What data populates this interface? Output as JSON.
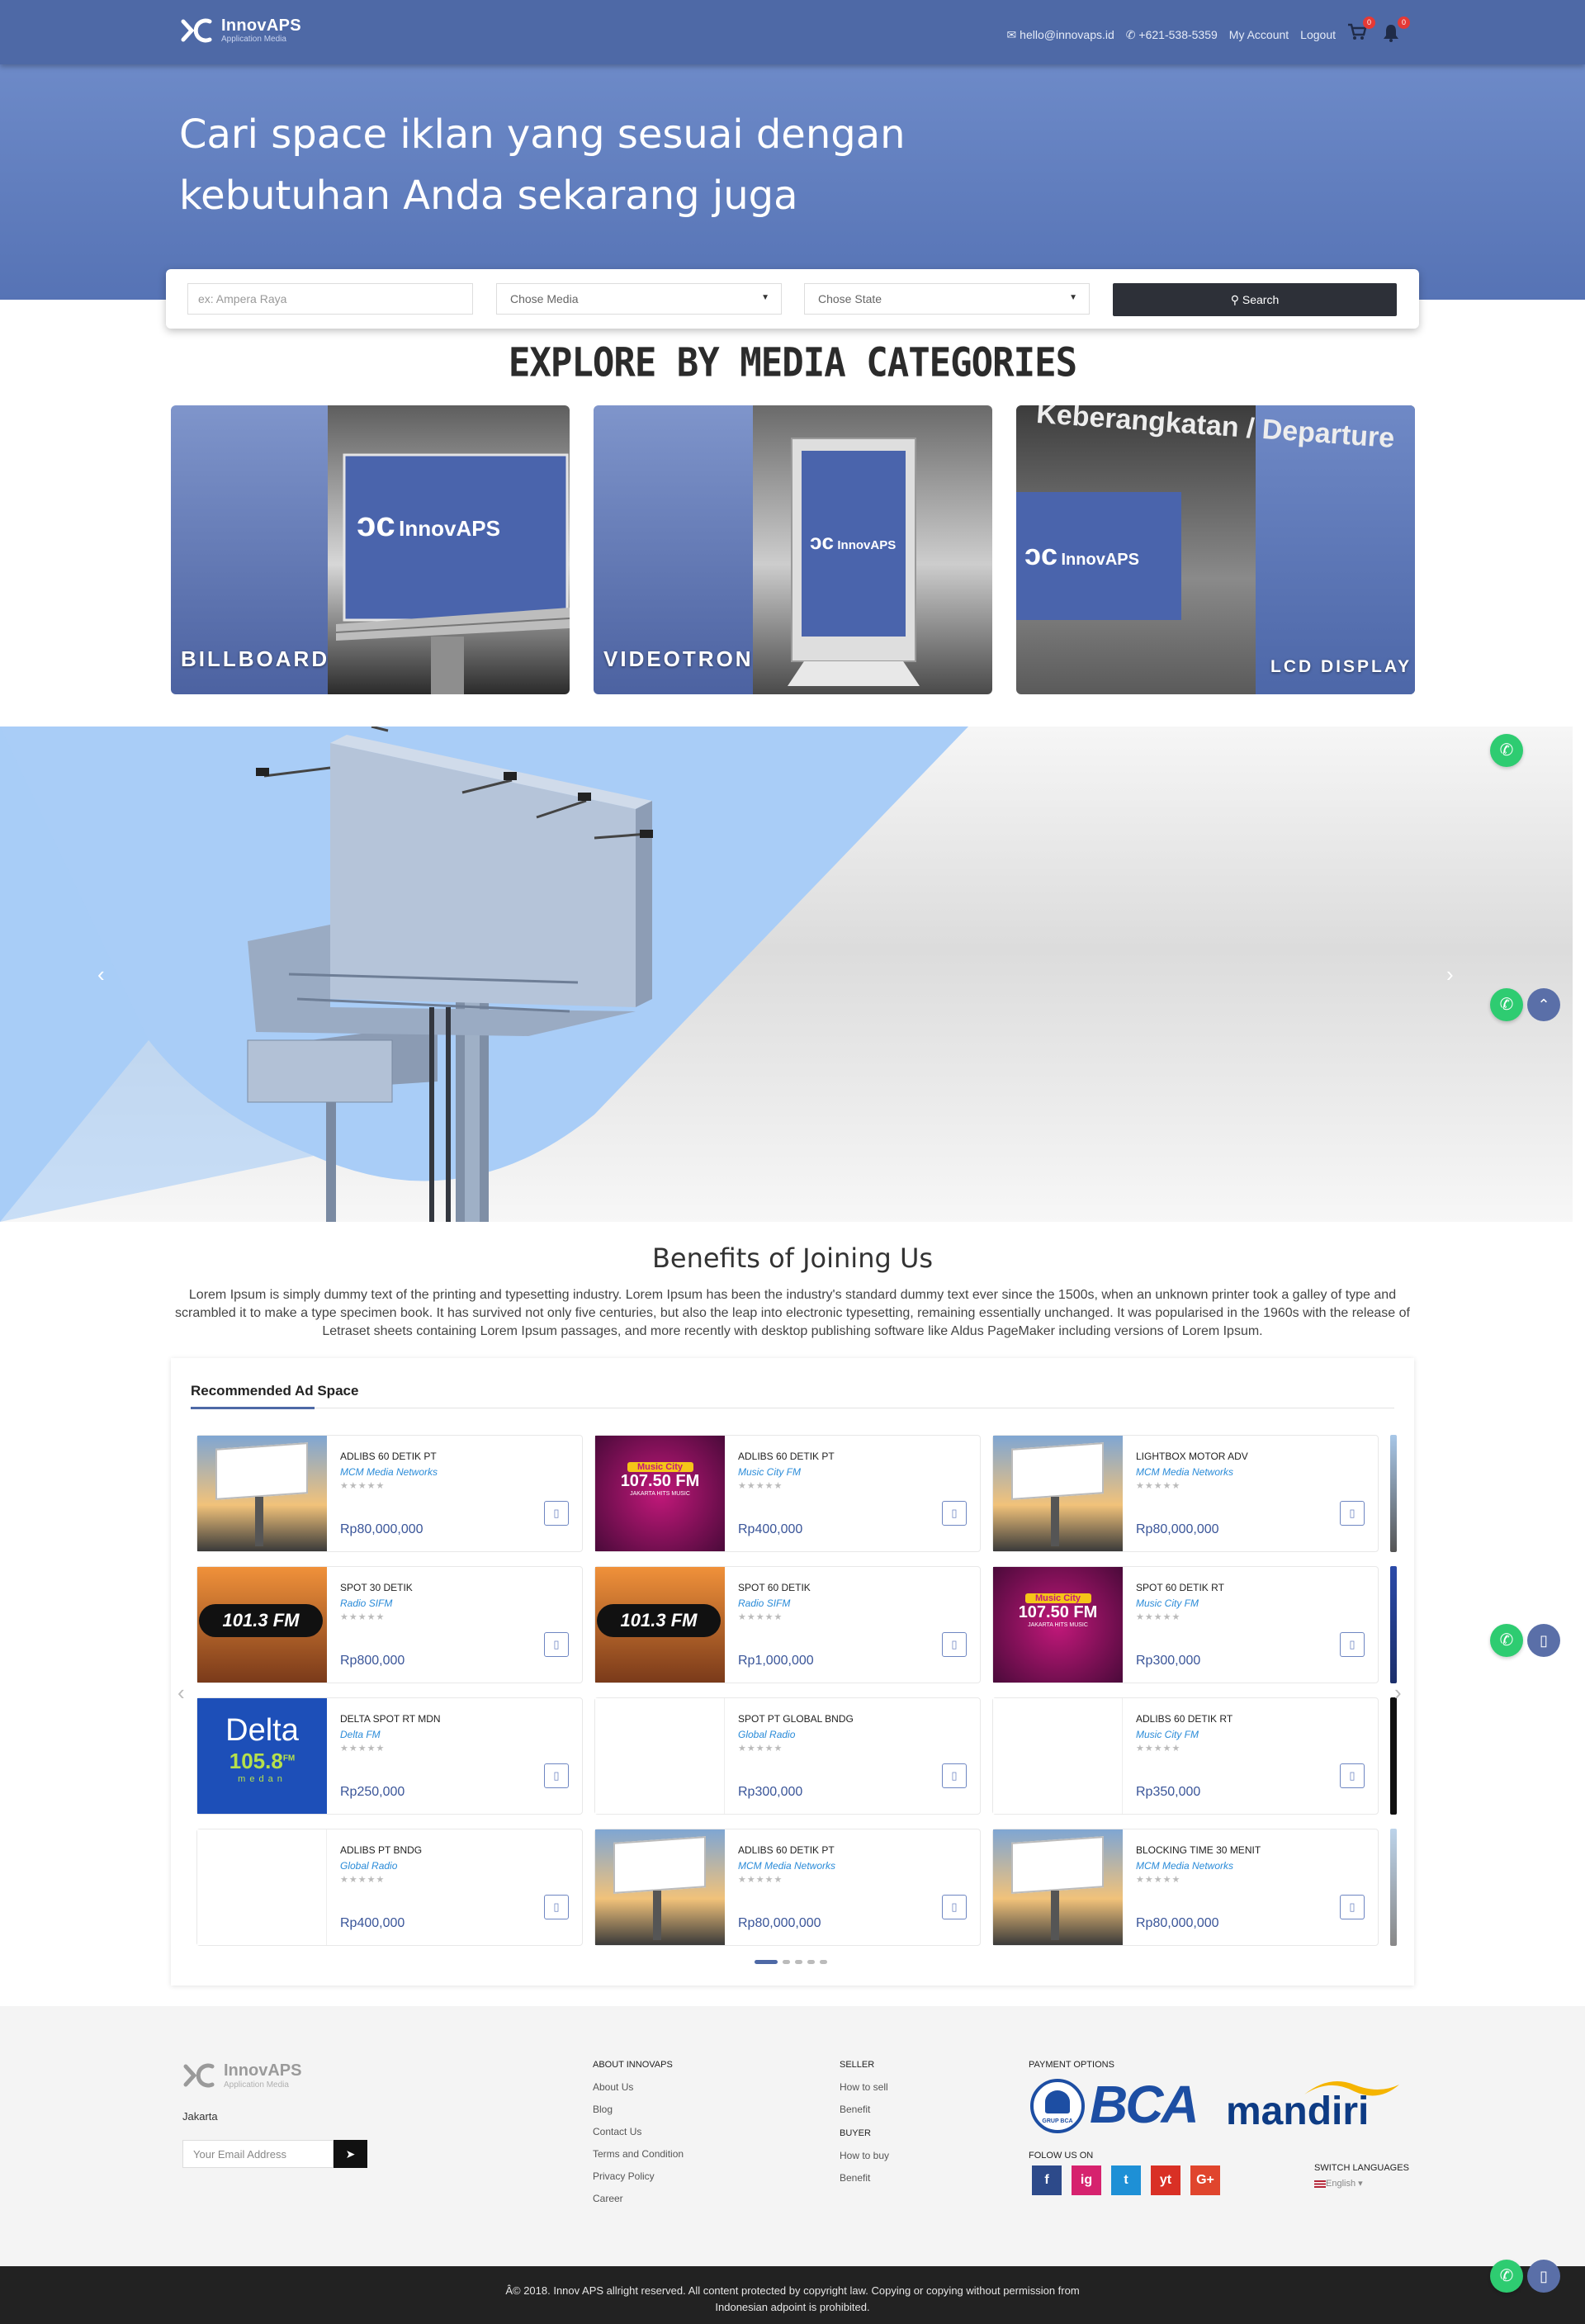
{
  "header": {
    "logo_name": "InnovAPS",
    "logo_sub": "Application Media",
    "email": "hello@innovaps.id",
    "phone": "+621-538-5359",
    "my_account": "My Account",
    "logout": "Logout",
    "cart_count": "0",
    "notif_count": "0"
  },
  "hero": {
    "headline_line1": "Cari space iklan yang sesuai dengan",
    "headline_line2": "kebutuhan Anda sekarang juga"
  },
  "search": {
    "placeholder": "ex: Ampera Raya",
    "media_select": "Chose Media",
    "state_select": "Chose State",
    "button": "Search"
  },
  "categories": {
    "title": "EXPLORE BY MEDIA CATEGORIES",
    "items": [
      {
        "label": "BILLBOARD",
        "panel_text": "InnovAPS"
      },
      {
        "label": "VIDEOTRON",
        "panel_text": "InnovAPS"
      },
      {
        "label": "LCD DISPLAY",
        "panel_text": "InnovAPS",
        "sign_text": "Keberangkatan / Departure"
      }
    ]
  },
  "benefits": {
    "title": "Benefits of Joining Us",
    "text": "Lorem Ipsum is simply dummy text of the printing and typesetting industry. Lorem Ipsum has been the industry's standard dummy text ever since the 1500s, when an unknown printer took a galley of type and scrambled it to make a type specimen book. It has survived not only five centuries, but also the leap into electronic typesetting, remaining essentially unchanged. It was popularised in the 1960s with the release of Letraset sheets containing Lorem Ipsum passages, and more recently with desktop publishing software like Aldus PageMaker including versions of Lorem Ipsum."
  },
  "recommended": {
    "title": "Recommended Ad Space",
    "stars": "★★★★★",
    "items": [
      {
        "title": "ADLIBS 60 DETIK PT",
        "seller": "MCM Media Networks",
        "price": "Rp80,000,000",
        "thumb": "billboard"
      },
      {
        "title": "ADLIBS 60 DETIK PT",
        "seller": "Music City FM",
        "price": "Rp400,000",
        "thumb": "musiccity"
      },
      {
        "title": "LIGHTBOX MOTOR ADV",
        "seller": "MCM Media Networks",
        "price": "Rp80,000,000",
        "thumb": "billboard"
      },
      {
        "title": "SPOT 30 DETIK",
        "seller": "Radio SIFM",
        "price": "Rp800,000",
        "thumb": "sifm"
      },
      {
        "title": "SPOT 60 DETIK",
        "seller": "Radio SIFM",
        "price": "Rp1,000,000",
        "thumb": "sifm"
      },
      {
        "title": "SPOT 60 DETIK RT",
        "seller": "Music City FM",
        "price": "Rp300,000",
        "thumb": "musiccity"
      },
      {
        "title": "DELTA SPOT RT MDN",
        "seller": "Delta FM",
        "price": "Rp250,000",
        "thumb": "delta"
      },
      {
        "title": "SPOT PT GLOBAL BNDG",
        "seller": "Global Radio",
        "price": "Rp300,000",
        "thumb": "blank"
      },
      {
        "title": "ADLIBS 60 DETIK RT",
        "seller": "Music City FM",
        "price": "Rp350,000",
        "thumb": "blank"
      },
      {
        "title": "ADLIBS PT BNDG",
        "seller": "Global Radio",
        "price": "Rp400,000",
        "thumb": "blank"
      },
      {
        "title": "ADLIBS 60 DETIK PT",
        "seller": "MCM Media Networks",
        "price": "Rp80,000,000",
        "thumb": "billboard"
      },
      {
        "title": "BLOCKING TIME 30 MENIT",
        "seller": "MCM Media Networks",
        "price": "Rp80,000,000",
        "thumb": "billboard"
      }
    ],
    "thumb_text": {
      "musiccity_top": "Music City",
      "musiccity_freq": "107.50 FM",
      "musiccity_tag": "JAKARTA HITS MUSIC",
      "sifm": "101.3 FM",
      "delta_name": "Delta",
      "delta_freq": "105.8",
      "delta_fm": "FM",
      "delta_city": "medan"
    }
  },
  "footer": {
    "logo_name": "InnovAPS",
    "logo_sub": "Application Media",
    "city": "Jakarta",
    "email_placeholder": "Your Email Address",
    "about_title": "ABOUT INNOVAPS",
    "about_links": [
      "About Us",
      "Blog",
      "Contact Us",
      "Terms and Condition",
      "Privacy Policy",
      "Career"
    ],
    "seller_title": "SELLER",
    "seller_links": [
      "How to sell",
      "Benefit"
    ],
    "buyer_title": "BUYER",
    "buyer_links": [
      "How to buy",
      "Benefit"
    ],
    "payment_title": "PAYMENT OPTIONS",
    "bank1": "BCA",
    "bank1_sub": "GRUP BCA",
    "bank2": "mandiri",
    "follow_title": "FOLOW US ON",
    "social": [
      "f",
      "ig",
      "t",
      "yt",
      "G+"
    ],
    "lang_title": "SWITCH LANGUAGES",
    "lang_value": "English",
    "copyright_line1": "Â© 2018. Innov APS allright reserved. All content protected by copyright law. Copying or copying without permission from",
    "copyright_line2": "Indonesian adpoint is prohibited."
  },
  "colors": {
    "primary": "#4e69a6",
    "dark": "#2d3038",
    "price": "#3a5599",
    "seller": "#2a8bd8",
    "whatsapp": "#2ecc71"
  }
}
